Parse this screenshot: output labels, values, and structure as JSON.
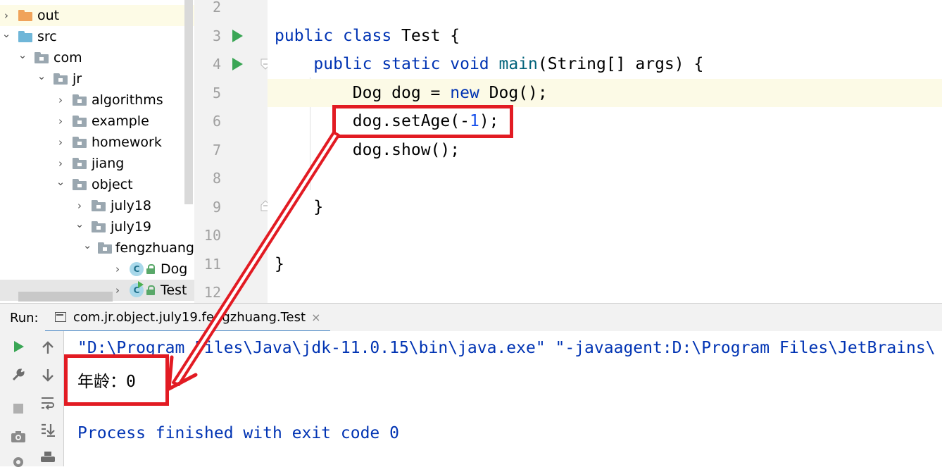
{
  "project_tree": [
    {
      "label": "out",
      "indent": 0,
      "arrow": "›",
      "icon": "folder-orange",
      "style": "hl-out"
    },
    {
      "label": "src",
      "indent": 0,
      "arrow": "⌄",
      "icon": "folder-blue"
    },
    {
      "label": "com",
      "indent": 1,
      "arrow": "⌄",
      "icon": "folder-grey"
    },
    {
      "label": "jr",
      "indent": 2,
      "arrow": "⌄",
      "icon": "folder-grey"
    },
    {
      "label": "algorithms",
      "indent": 3,
      "arrow": "›",
      "icon": "folder-grey"
    },
    {
      "label": "example",
      "indent": 3,
      "arrow": "›",
      "icon": "folder-grey"
    },
    {
      "label": "homework",
      "indent": 3,
      "arrow": "›",
      "icon": "folder-grey"
    },
    {
      "label": "jiang",
      "indent": 3,
      "arrow": "›",
      "icon": "folder-grey"
    },
    {
      "label": "object",
      "indent": 3,
      "arrow": "⌄",
      "icon": "folder-grey"
    },
    {
      "label": "july18",
      "indent": 4,
      "arrow": "›",
      "icon": "folder-grey"
    },
    {
      "label": "july19",
      "indent": 4,
      "arrow": "⌄",
      "icon": "folder-grey"
    },
    {
      "label": "fengzhuang",
      "indent": 5,
      "arrow": "⌄",
      "icon": "folder-grey"
    },
    {
      "label": "Dog",
      "indent": 6,
      "arrow": "›",
      "icon": "class"
    },
    {
      "label": "Test",
      "indent": 6,
      "arrow": "›",
      "icon": "class-run",
      "style": "sel"
    }
  ],
  "editor": {
    "line_numbers": [
      "2",
      "3",
      "4",
      "5",
      "6",
      "7",
      "8",
      "9",
      "10",
      "11",
      "12"
    ],
    "run_gutter_lines": [
      "3",
      "4"
    ],
    "lines": [
      [],
      [
        {
          "t": "public ",
          "c": "kw"
        },
        {
          "t": "class ",
          "c": "kw"
        },
        {
          "t": "Test {",
          "c": ""
        }
      ],
      [
        {
          "t": "    ",
          "c": ""
        },
        {
          "t": "public ",
          "c": "kw"
        },
        {
          "t": "static ",
          "c": "kw"
        },
        {
          "t": "void ",
          "c": "kw"
        },
        {
          "t": "main",
          "c": "fn"
        },
        {
          "t": "(String[] args) {",
          "c": ""
        }
      ],
      [
        {
          "t": "        Dog dog = ",
          "c": ""
        },
        {
          "t": "new ",
          "c": "kw"
        },
        {
          "t": "Dog();",
          "c": ""
        }
      ],
      [
        {
          "t": "        dog.setAge(-",
          "c": ""
        },
        {
          "t": "1",
          "c": "num"
        },
        {
          "t": ");",
          "c": ""
        }
      ],
      [
        {
          "t": "        dog.show();",
          "c": ""
        }
      ],
      [],
      [
        {
          "t": "    }",
          "c": ""
        }
      ],
      [],
      [
        {
          "t": "}",
          "c": ""
        }
      ],
      []
    ]
  },
  "run_panel": {
    "label": "Run:",
    "tab_title": "com.jr.object.july19.fengzhuang.Test",
    "tab_close": "×",
    "toolbar_left": [
      "run-icon",
      "wrench-icon",
      "stop-icon",
      "camera-icon",
      "settings-icon"
    ],
    "toolbar_right": [
      "up-arrow-icon",
      "down-arrow-icon",
      "soft-wrap-icon",
      "scroll-to-end-icon",
      "print-icon"
    ]
  },
  "console": {
    "command": "\"D:\\Program Files\\Java\\jdk-11.0.15\\bin\\java.exe\" \"-javaagent:D:\\Program Files\\JetBrains\\",
    "output": "年龄：0",
    "exit": "Process finished with exit code 0"
  },
  "annotation_color": "#e21b23"
}
